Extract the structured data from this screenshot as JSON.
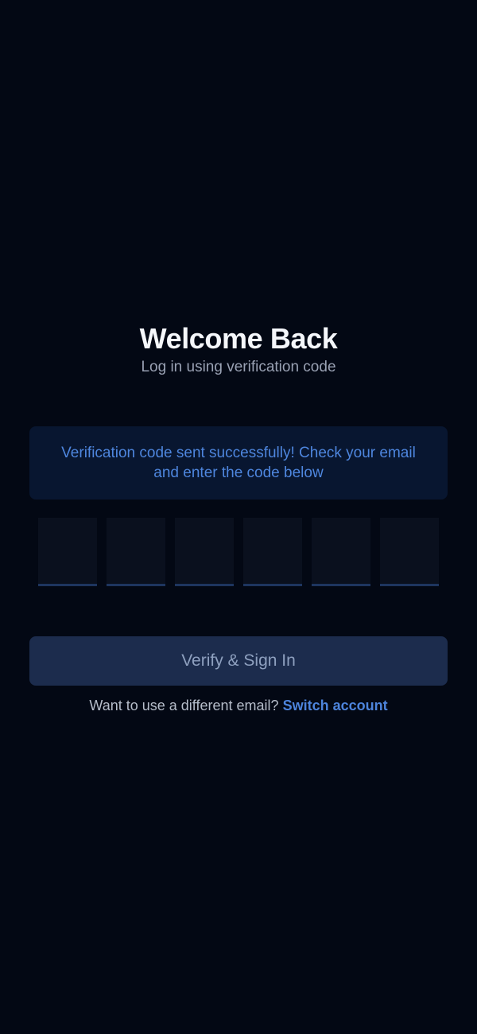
{
  "header": {
    "title": "Welcome Back",
    "subtitle": "Log in using verification code"
  },
  "alert": {
    "message": "Verification code sent successfully! Check your email and enter the code below"
  },
  "otp": {
    "cells": [
      "",
      "",
      "",
      "",
      "",
      ""
    ]
  },
  "actions": {
    "verify_label": "Verify & Sign In",
    "switch_prompt": "Want to use a different email?",
    "switch_link": "Switch account"
  },
  "colors": {
    "background": "#030814",
    "alert_background": "#081630",
    "accent": "#4e86de",
    "button_background": "#1c2c4d",
    "button_text": "#8ea0bf"
  }
}
